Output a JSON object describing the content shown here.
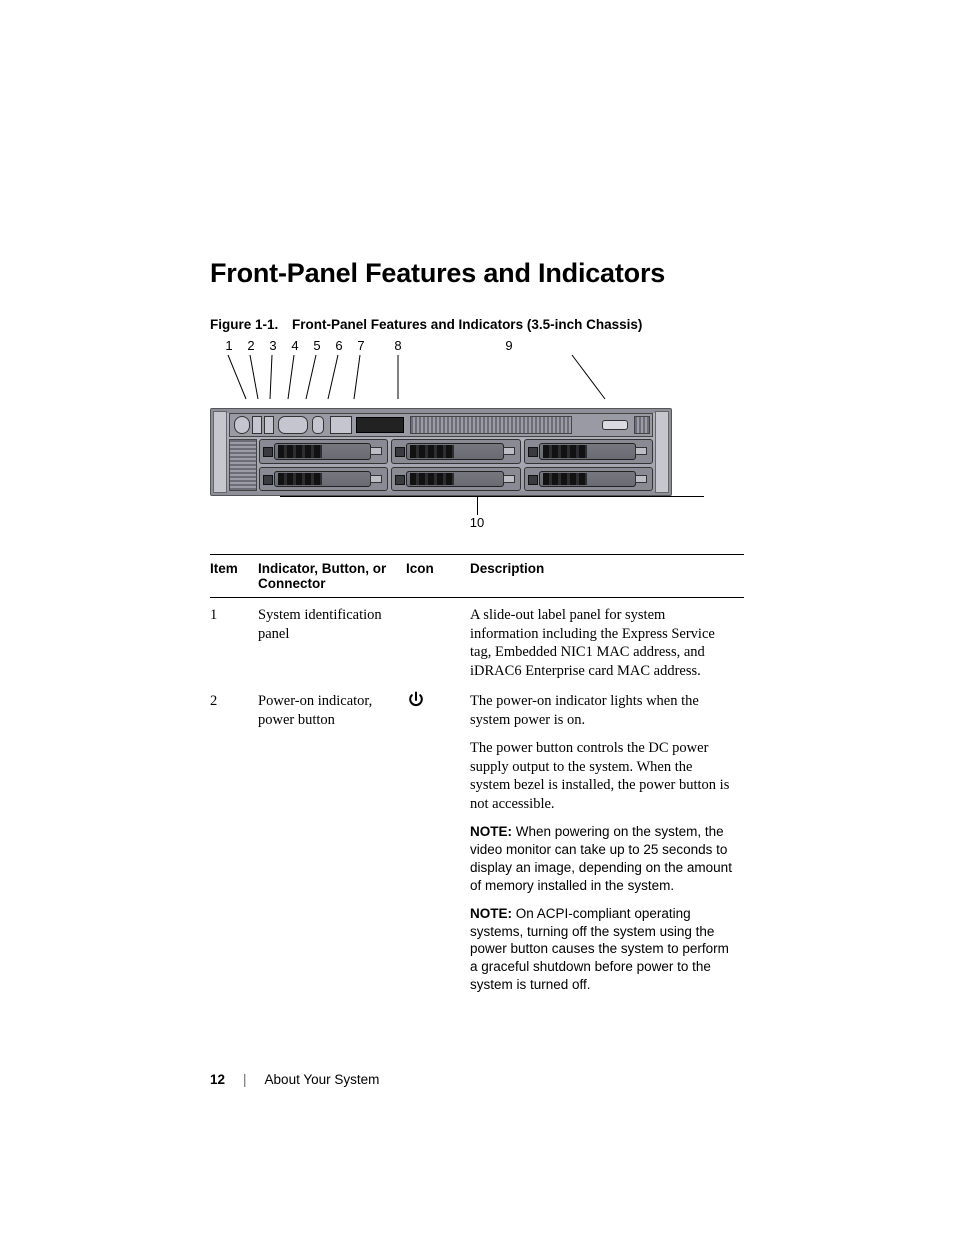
{
  "heading": "Front-Panel Features and Indicators",
  "figure": {
    "number": "Figure 1-1.",
    "title": "Front-Panel Features and Indicators (3.5-inch Chassis)",
    "callouts_top": [
      "1",
      "2",
      "3",
      "4",
      "5",
      "6",
      "7",
      "8",
      "9"
    ],
    "callout_bottom": "10"
  },
  "table": {
    "headers": {
      "item": "Item",
      "indicator": "Indicator, Button, or Connector",
      "icon": "Icon",
      "description": "Description"
    },
    "rows": [
      {
        "item": "1",
        "indicator": "System identification panel",
        "icon": null,
        "description_paragraphs": [
          "A slide-out label panel for system information including the Express Service tag, Embedded NIC1 MAC address, and iDRAC6 Enterprise card MAC address."
        ],
        "notes": []
      },
      {
        "item": "2",
        "indicator": "Power-on indicator, power button",
        "icon": "power-icon",
        "description_paragraphs": [
          "The power-on indicator lights when the system power is on.",
          "The power button controls the DC power supply output to the system. When the system bezel is installed, the power button is not accessible."
        ],
        "notes": [
          "When powering on the system, the video monitor can take up to 25 seconds to display an image, depending on the amount of memory installed in the system.",
          "On ACPI-compliant operating systems, turning off the system using the power button causes the system to perform a graceful shutdown before power to the system is turned off."
        ]
      }
    ]
  },
  "note_label": "NOTE:",
  "footer": {
    "page_number": "12",
    "separator": "|",
    "section": "About Your System"
  }
}
